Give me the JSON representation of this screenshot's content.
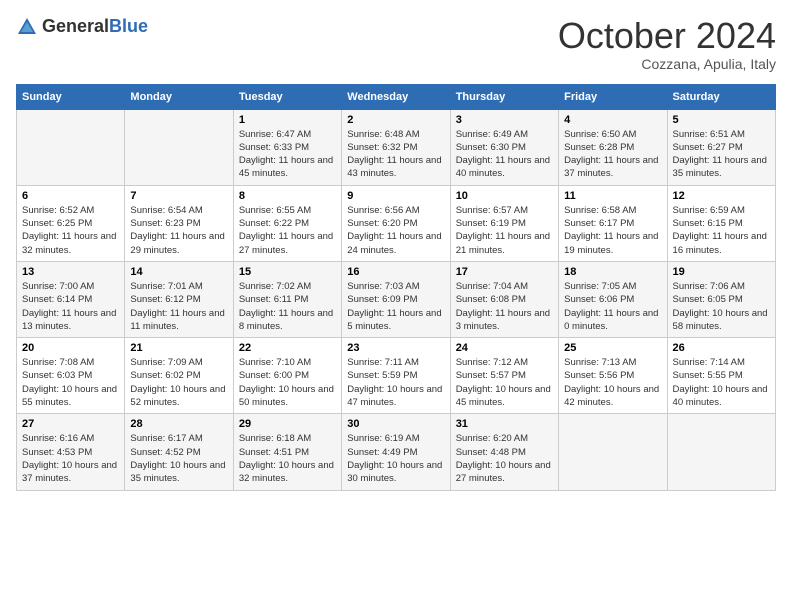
{
  "header": {
    "logo_general": "General",
    "logo_blue": "Blue",
    "month": "October 2024",
    "location": "Cozzana, Apulia, Italy"
  },
  "columns": [
    "Sunday",
    "Monday",
    "Tuesday",
    "Wednesday",
    "Thursday",
    "Friday",
    "Saturday"
  ],
  "weeks": [
    [
      {
        "day": "",
        "info": ""
      },
      {
        "day": "",
        "info": ""
      },
      {
        "day": "1",
        "info": "Sunrise: 6:47 AM\nSunset: 6:33 PM\nDaylight: 11 hours and 45 minutes."
      },
      {
        "day": "2",
        "info": "Sunrise: 6:48 AM\nSunset: 6:32 PM\nDaylight: 11 hours and 43 minutes."
      },
      {
        "day": "3",
        "info": "Sunrise: 6:49 AM\nSunset: 6:30 PM\nDaylight: 11 hours and 40 minutes."
      },
      {
        "day": "4",
        "info": "Sunrise: 6:50 AM\nSunset: 6:28 PM\nDaylight: 11 hours and 37 minutes."
      },
      {
        "day": "5",
        "info": "Sunrise: 6:51 AM\nSunset: 6:27 PM\nDaylight: 11 hours and 35 minutes."
      }
    ],
    [
      {
        "day": "6",
        "info": "Sunrise: 6:52 AM\nSunset: 6:25 PM\nDaylight: 11 hours and 32 minutes."
      },
      {
        "day": "7",
        "info": "Sunrise: 6:54 AM\nSunset: 6:23 PM\nDaylight: 11 hours and 29 minutes."
      },
      {
        "day": "8",
        "info": "Sunrise: 6:55 AM\nSunset: 6:22 PM\nDaylight: 11 hours and 27 minutes."
      },
      {
        "day": "9",
        "info": "Sunrise: 6:56 AM\nSunset: 6:20 PM\nDaylight: 11 hours and 24 minutes."
      },
      {
        "day": "10",
        "info": "Sunrise: 6:57 AM\nSunset: 6:19 PM\nDaylight: 11 hours and 21 minutes."
      },
      {
        "day": "11",
        "info": "Sunrise: 6:58 AM\nSunset: 6:17 PM\nDaylight: 11 hours and 19 minutes."
      },
      {
        "day": "12",
        "info": "Sunrise: 6:59 AM\nSunset: 6:15 PM\nDaylight: 11 hours and 16 minutes."
      }
    ],
    [
      {
        "day": "13",
        "info": "Sunrise: 7:00 AM\nSunset: 6:14 PM\nDaylight: 11 hours and 13 minutes."
      },
      {
        "day": "14",
        "info": "Sunrise: 7:01 AM\nSunset: 6:12 PM\nDaylight: 11 hours and 11 minutes."
      },
      {
        "day": "15",
        "info": "Sunrise: 7:02 AM\nSunset: 6:11 PM\nDaylight: 11 hours and 8 minutes."
      },
      {
        "day": "16",
        "info": "Sunrise: 7:03 AM\nSunset: 6:09 PM\nDaylight: 11 hours and 5 minutes."
      },
      {
        "day": "17",
        "info": "Sunrise: 7:04 AM\nSunset: 6:08 PM\nDaylight: 11 hours and 3 minutes."
      },
      {
        "day": "18",
        "info": "Sunrise: 7:05 AM\nSunset: 6:06 PM\nDaylight: 11 hours and 0 minutes."
      },
      {
        "day": "19",
        "info": "Sunrise: 7:06 AM\nSunset: 6:05 PM\nDaylight: 10 hours and 58 minutes."
      }
    ],
    [
      {
        "day": "20",
        "info": "Sunrise: 7:08 AM\nSunset: 6:03 PM\nDaylight: 10 hours and 55 minutes."
      },
      {
        "day": "21",
        "info": "Sunrise: 7:09 AM\nSunset: 6:02 PM\nDaylight: 10 hours and 52 minutes."
      },
      {
        "day": "22",
        "info": "Sunrise: 7:10 AM\nSunset: 6:00 PM\nDaylight: 10 hours and 50 minutes."
      },
      {
        "day": "23",
        "info": "Sunrise: 7:11 AM\nSunset: 5:59 PM\nDaylight: 10 hours and 47 minutes."
      },
      {
        "day": "24",
        "info": "Sunrise: 7:12 AM\nSunset: 5:57 PM\nDaylight: 10 hours and 45 minutes."
      },
      {
        "day": "25",
        "info": "Sunrise: 7:13 AM\nSunset: 5:56 PM\nDaylight: 10 hours and 42 minutes."
      },
      {
        "day": "26",
        "info": "Sunrise: 7:14 AM\nSunset: 5:55 PM\nDaylight: 10 hours and 40 minutes."
      }
    ],
    [
      {
        "day": "27",
        "info": "Sunrise: 6:16 AM\nSunset: 4:53 PM\nDaylight: 10 hours and 37 minutes."
      },
      {
        "day": "28",
        "info": "Sunrise: 6:17 AM\nSunset: 4:52 PM\nDaylight: 10 hours and 35 minutes."
      },
      {
        "day": "29",
        "info": "Sunrise: 6:18 AM\nSunset: 4:51 PM\nDaylight: 10 hours and 32 minutes."
      },
      {
        "day": "30",
        "info": "Sunrise: 6:19 AM\nSunset: 4:49 PM\nDaylight: 10 hours and 30 minutes."
      },
      {
        "day": "31",
        "info": "Sunrise: 6:20 AM\nSunset: 4:48 PM\nDaylight: 10 hours and 27 minutes."
      },
      {
        "day": "",
        "info": ""
      },
      {
        "day": "",
        "info": ""
      }
    ]
  ]
}
